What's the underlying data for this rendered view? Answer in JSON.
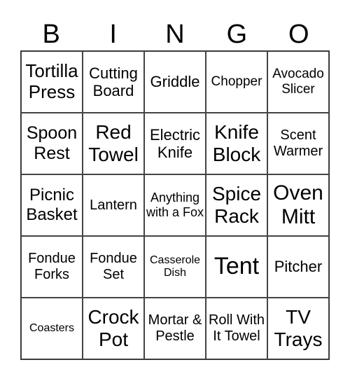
{
  "header": [
    "B",
    "I",
    "N",
    "G",
    "O"
  ],
  "cells": [
    "Tortilla Press",
    "Cutting Board",
    "Griddle",
    "Chopper",
    "Avocado Slicer",
    "Spoon Rest",
    "Red Towel",
    "Electric Knife",
    "Knife Block",
    "Scent Warmer",
    "Picnic Basket",
    "Lantern",
    "Anything with a Fox",
    "Spice Rack",
    "Oven Mitt",
    "Fondue Forks",
    "Fondue Set",
    "Casserole Dish",
    "Tent",
    "Pitcher",
    "Coasters",
    "Crock Pot",
    "Mortar & Pestle",
    "Roll With It Towel",
    "TV Trays"
  ]
}
